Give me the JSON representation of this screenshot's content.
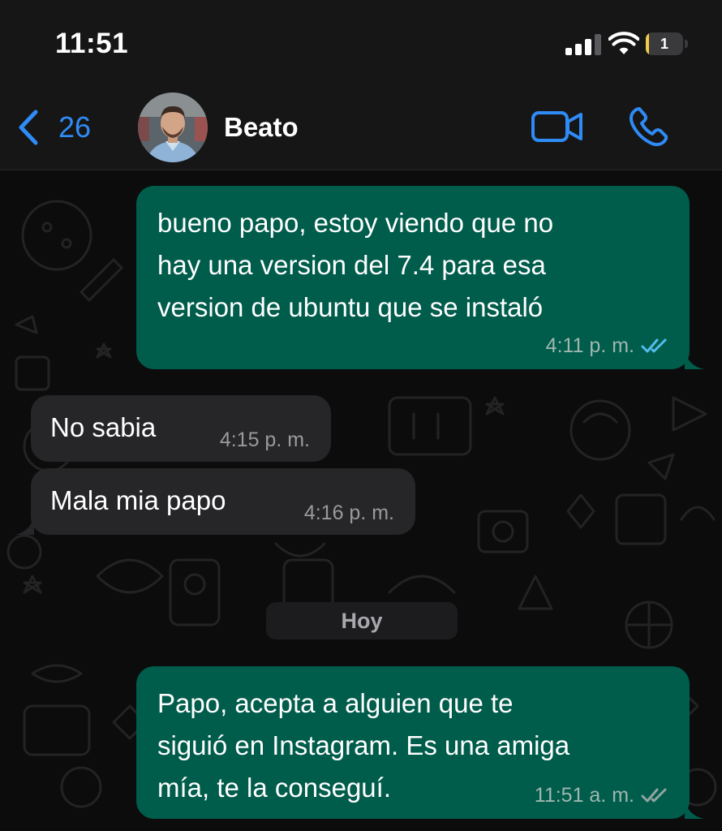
{
  "status_bar": {
    "time": "11:51",
    "battery_level": "1",
    "battery_fraction": 0.08,
    "signal_bars_active": 3,
    "signal_bars_total": 4
  },
  "header": {
    "back_count": "26",
    "contact_name": "Beato",
    "icons": {
      "back": "chevron-left-icon",
      "video": "video-camera-icon",
      "voice": "phone-icon"
    },
    "accent_color": "#2f8bf5"
  },
  "messages": [
    {
      "direction": "outgoing",
      "lines": [
        "bueno papo, estoy viendo que no",
        "hay una version del 7.4 para esa",
        "version de ubuntu que se instaló"
      ],
      "time": "4:11 p. m.",
      "status": "read"
    },
    {
      "direction": "incoming",
      "text": "No sabia",
      "time": "4:15 p. m."
    },
    {
      "direction": "incoming",
      "text": "Mala mia papo",
      "time": "4:16 p. m."
    },
    {
      "direction": "outgoing",
      "lines": [
        "Papo, acepta a alguien que te",
        "siguió en Instagram. Es una amiga",
        "mía, te la conseguí."
      ],
      "time": "11:51 a. m.",
      "status": "delivered"
    }
  ],
  "date_separator": "Hoy",
  "colors": {
    "outgoing_bubble": "#005c4b",
    "incoming_bubble": "#262628",
    "read_ticks": "#53bdeb",
    "delivered_ticks": "#8fa5a0"
  }
}
